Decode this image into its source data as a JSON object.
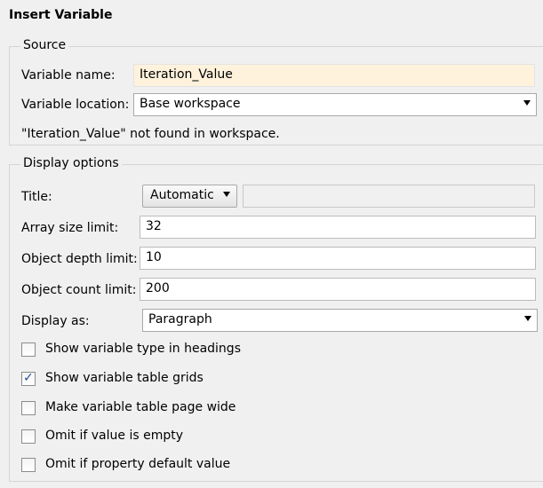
{
  "dialog": {
    "title": "Insert Variable"
  },
  "source": {
    "legend": "Source",
    "variable_name_label": "Variable name:",
    "variable_name_value": "Iteration_Value",
    "variable_location_label": "Variable location:",
    "variable_location_value": "Base workspace",
    "status_message": "\"Iteration_Value\" not found in workspace."
  },
  "display": {
    "legend": "Display options",
    "title_label": "Title:",
    "title_mode": "Automatic",
    "title_text": "",
    "array_label": "Array size limit:",
    "array_value": "32",
    "depth_label": "Object depth limit:",
    "depth_value": "10",
    "count_label": "Object count limit:",
    "count_value": "200",
    "display_as_label": "Display as:",
    "display_as_value": "Paragraph",
    "checkboxes": [
      {
        "label": "Show variable type in headings",
        "checked": false
      },
      {
        "label": "Show variable table grids",
        "checked": true
      },
      {
        "label": "Make variable table page wide",
        "checked": false
      },
      {
        "label": "Omit if value is empty",
        "checked": false
      },
      {
        "label": "Omit if property default value",
        "checked": false
      }
    ]
  },
  "colors": {
    "highlight_field": "#fff2dc",
    "checkmark": "#2a4d97",
    "background": "#f0f0f0"
  }
}
